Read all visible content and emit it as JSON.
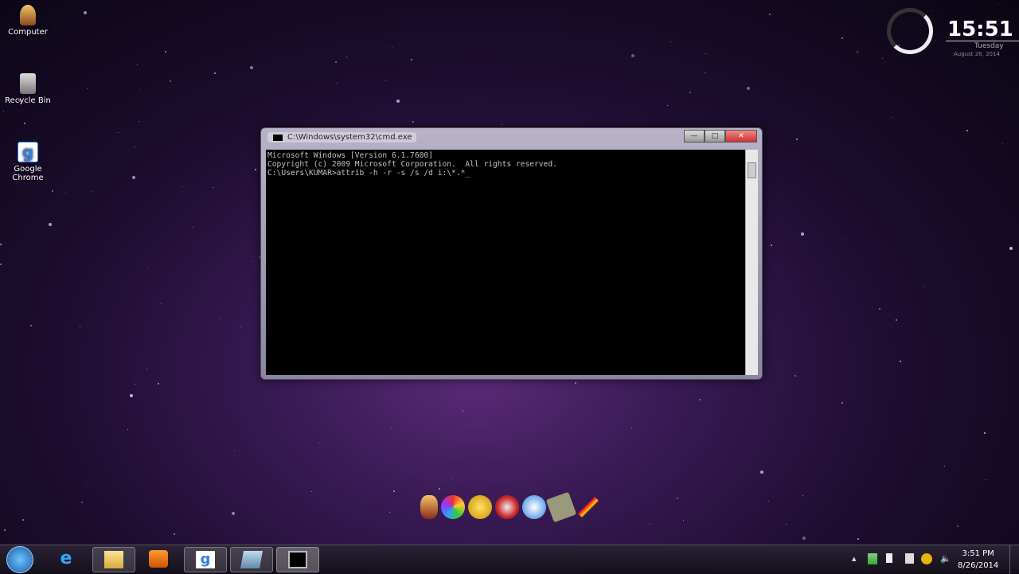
{
  "desktop": {
    "icons": [
      {
        "label": "Computer"
      },
      {
        "label": "Recycle Bin"
      },
      {
        "label": "Google Chrome"
      }
    ]
  },
  "cmd_window": {
    "title": "C:\\Windows\\system32\\cmd.exe",
    "lines": [
      "Microsoft Windows [Version 6.1.7600]",
      "Copyright (c) 2009 Microsoft Corporation.  All rights reserved.",
      "",
      "C:\\Users\\KUMAR>attrib -h -r -s /s /d i:\\*.*_"
    ],
    "minimize": "—",
    "maximize": "□",
    "close": "✕"
  },
  "clock_widget": {
    "time": "15:51",
    "day": "Tuesday",
    "date": "August 26, 2014"
  },
  "dock": {
    "icons": [
      "ironman-icon",
      "picasa-icon",
      "coin-icon",
      "speedometer-icon",
      "flash-icon",
      "notepad-icon",
      "lightning-icon"
    ]
  },
  "taskbar": {
    "items": [
      {
        "name": "internet-explorer-icon"
      },
      {
        "name": "explorer-icon"
      },
      {
        "name": "media-player-icon"
      },
      {
        "name": "chrome-icon"
      },
      {
        "name": "app-icon"
      },
      {
        "name": "cmd-icon"
      }
    ],
    "tray": {
      "time": "3:51 PM",
      "date": "8/26/2014",
      "show_hidden": "▴"
    }
  }
}
